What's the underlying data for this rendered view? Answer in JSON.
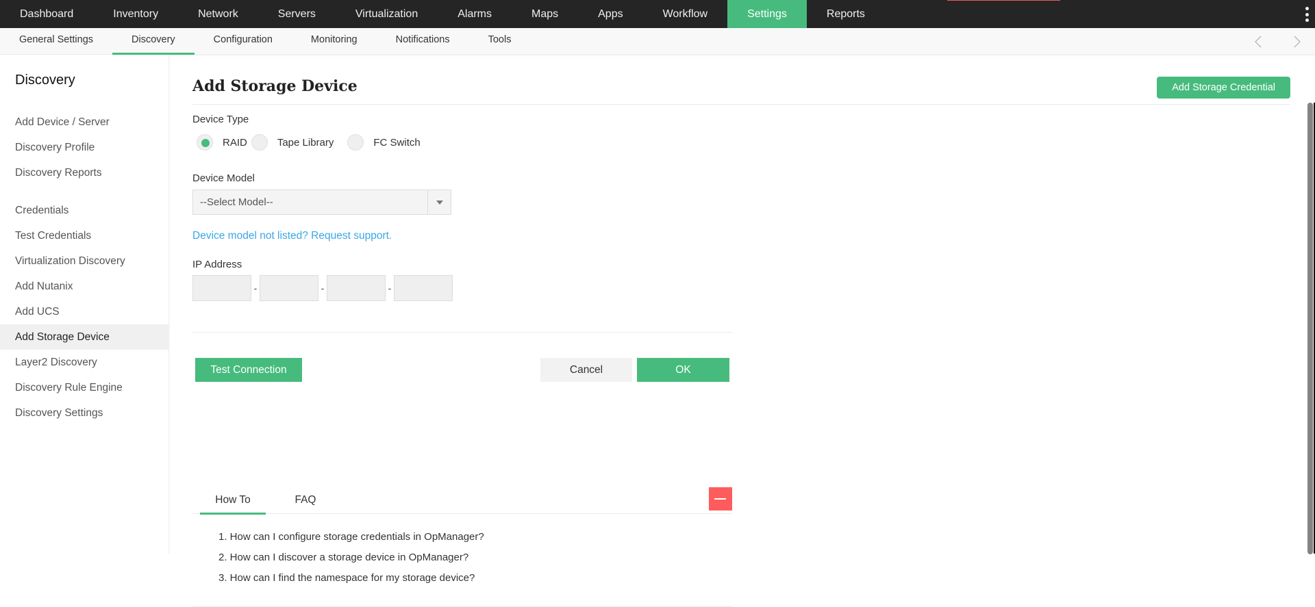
{
  "topnav": {
    "items": [
      {
        "label": "Dashboard"
      },
      {
        "label": "Inventory"
      },
      {
        "label": "Network"
      },
      {
        "label": "Servers"
      },
      {
        "label": "Virtualization"
      },
      {
        "label": "Alarms"
      },
      {
        "label": "Maps"
      },
      {
        "label": "Apps"
      },
      {
        "label": "Workflow"
      },
      {
        "label": "Settings",
        "active": true
      },
      {
        "label": "Reports"
      }
    ],
    "menu_icon": "kebab-menu-icon"
  },
  "subnav": {
    "tabs": [
      {
        "label": "General Settings"
      },
      {
        "label": "Discovery",
        "active": true
      },
      {
        "label": "Configuration"
      },
      {
        "label": "Monitoring"
      },
      {
        "label": "Notifications"
      },
      {
        "label": "Tools"
      }
    ],
    "prev_icon": "chevron-left-icon",
    "next_icon": "chevron-right-icon"
  },
  "sidebar": {
    "title": "Discovery",
    "group1": [
      {
        "label": "Add Device / Server"
      },
      {
        "label": "Discovery Profile"
      },
      {
        "label": "Discovery Reports"
      }
    ],
    "group2": [
      {
        "label": "Credentials"
      },
      {
        "label": "Test Credentials"
      },
      {
        "label": "Virtualization Discovery"
      },
      {
        "label": "Add Nutanix"
      },
      {
        "label": "Add UCS"
      },
      {
        "label": "Add Storage Device",
        "active": true
      },
      {
        "label": "Layer2 Discovery"
      },
      {
        "label": "Discovery Rule Engine"
      },
      {
        "label": "Discovery Settings"
      }
    ]
  },
  "main": {
    "title": "Add Storage Device",
    "add_credential_button": "Add Storage Credential",
    "device_type": {
      "label": "Device Type",
      "options": [
        {
          "label": "RAID",
          "checked": true
        },
        {
          "label": "Tape Library",
          "checked": false
        },
        {
          "label": "FC Switch",
          "checked": false
        }
      ]
    },
    "device_model": {
      "label": "Device Model",
      "selected": "--Select Model--"
    },
    "request_support_link": "Device model not listed? Request support.",
    "ip_address": {
      "label": "IP Address",
      "octets": [
        "",
        "",
        "",
        ""
      ],
      "separator": "-"
    },
    "buttons": {
      "test_connection": "Test Connection",
      "cancel": "Cancel",
      "ok": "OK"
    },
    "help": {
      "tabs": [
        {
          "label": "How To",
          "active": true
        },
        {
          "label": "FAQ"
        }
      ],
      "collapse_icon": "minus-icon",
      "items": [
        "1. How can I configure storage credentials in OpManager?",
        "2. How can I discover a storage device in OpManager?",
        "3. How can I find the namespace for my storage device?"
      ]
    }
  },
  "colors": {
    "accent": "#46bb7d",
    "topbar": "#252525",
    "link": "#3aa6e8",
    "danger": "#fe5c5c"
  }
}
